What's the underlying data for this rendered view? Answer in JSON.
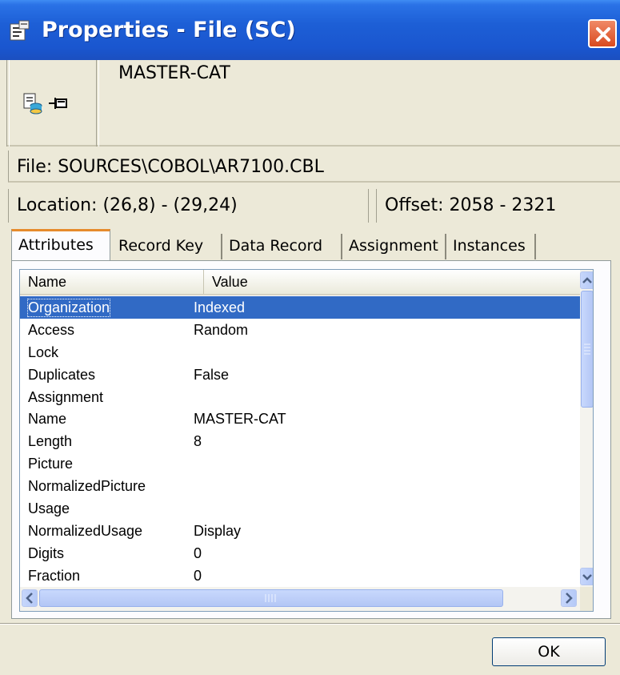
{
  "window": {
    "title": "Properties - File (SC)"
  },
  "header": {
    "object_name": "MASTER-CAT",
    "icons": [
      "properties-doc-icon",
      "pin-icon"
    ]
  },
  "file": {
    "label": "File: SOURCES\\COBOL\\AR7100.CBL"
  },
  "location": {
    "label": "Location: (26,8) - (29,24)"
  },
  "offset": {
    "label": "Offset: 2058 - 2321"
  },
  "tabs": [
    {
      "label": "Attributes",
      "active": true
    },
    {
      "label": "Record Key",
      "active": false
    },
    {
      "label": "Data Record",
      "active": false
    },
    {
      "label": "Assignment",
      "active": false
    },
    {
      "label": "Instances",
      "active": false
    }
  ],
  "listview": {
    "columns": [
      "Name",
      "Value"
    ],
    "rows": [
      {
        "name": "Organization",
        "value": "Indexed",
        "selected": true
      },
      {
        "name": "Access",
        "value": "Random"
      },
      {
        "name": "Lock",
        "value": ""
      },
      {
        "name": "Duplicates",
        "value": "False"
      },
      {
        "name": "Assignment",
        "value": ""
      },
      {
        "name": "Name",
        "value": "MASTER-CAT"
      },
      {
        "name": "Length",
        "value": "8"
      },
      {
        "name": "Picture",
        "value": ""
      },
      {
        "name": "NormalizedPicture",
        "value": ""
      },
      {
        "name": "Usage",
        "value": ""
      },
      {
        "name": "NormalizedUsage",
        "value": "Display"
      },
      {
        "name": "Digits",
        "value": "0"
      },
      {
        "name": "Fraction",
        "value": "0"
      }
    ]
  },
  "buttons": {
    "ok_label": "OK"
  },
  "colors": {
    "titlebar": "#1d5fd6",
    "selection": "#316ac5",
    "close": "#d94a1f",
    "tab_accent": "#e68b2c"
  }
}
